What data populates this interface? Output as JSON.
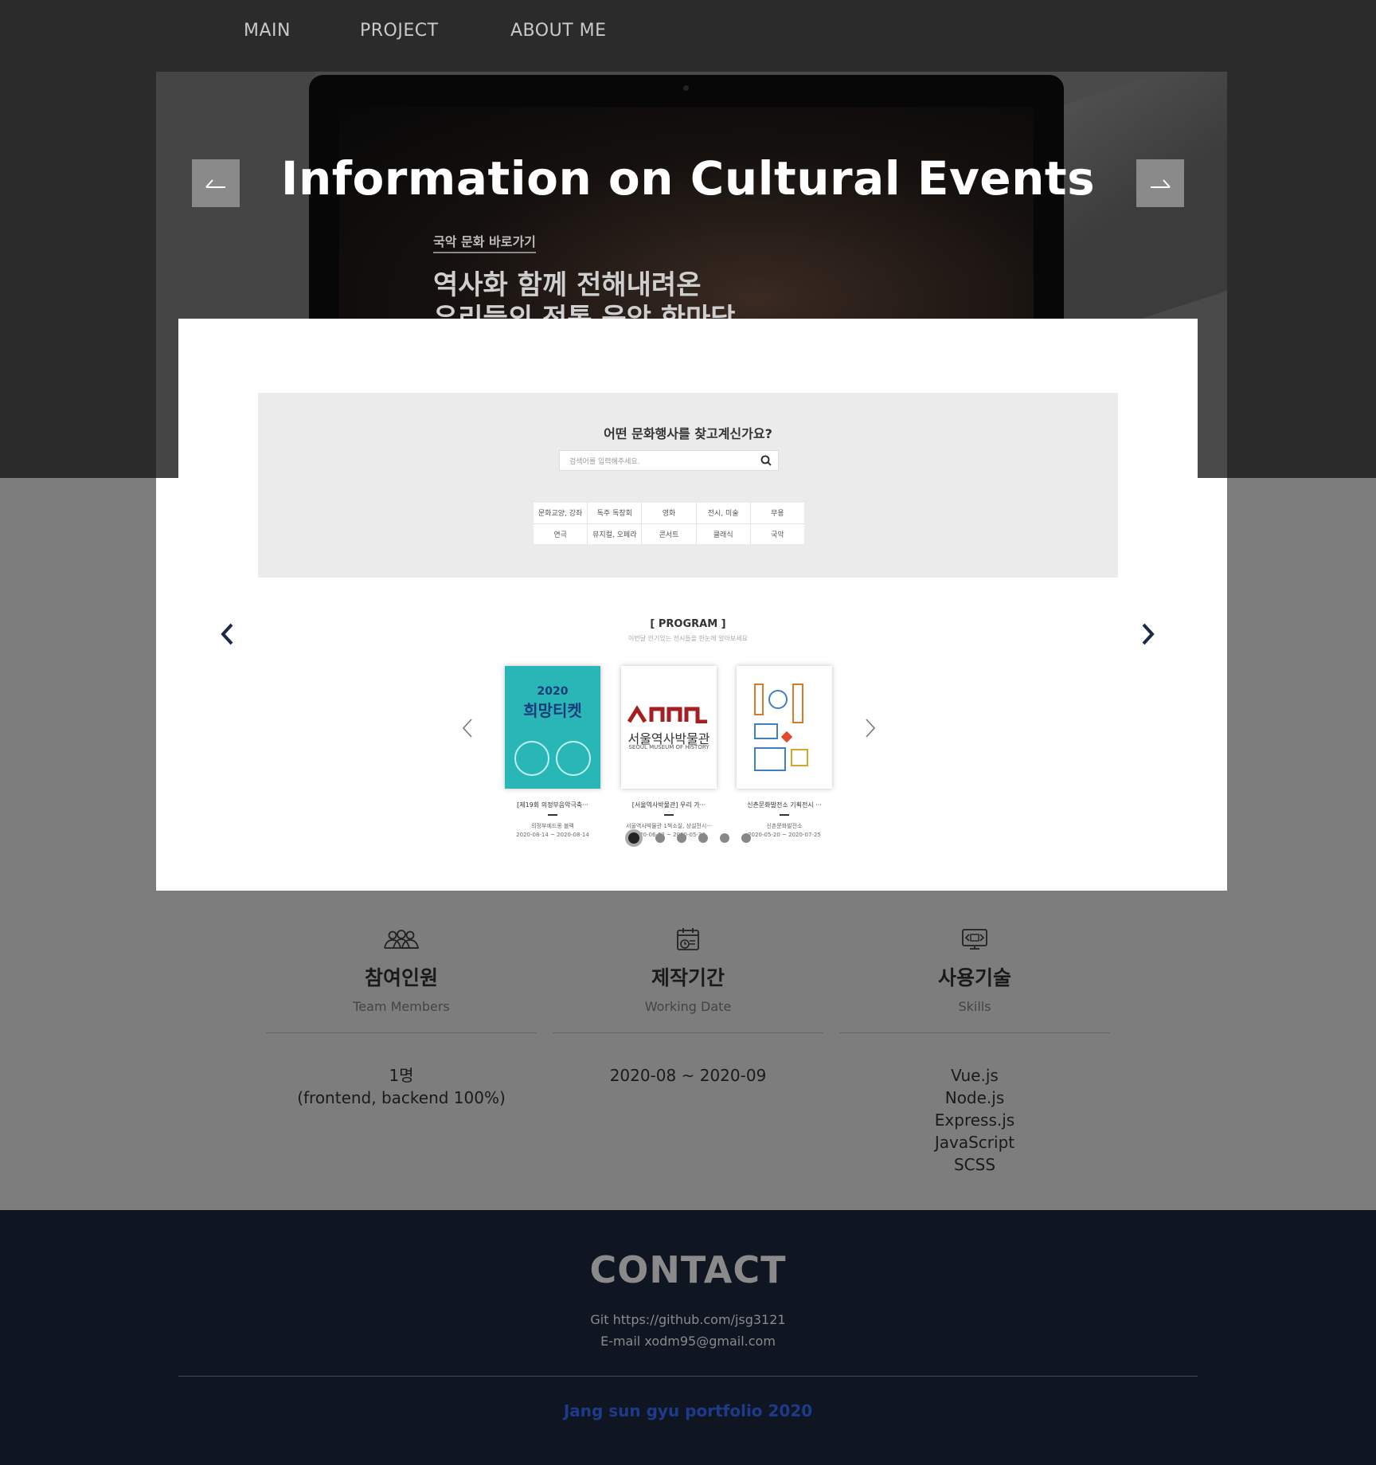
{
  "nav": {
    "items": [
      {
        "label": "MAIN"
      },
      {
        "label": "PROJECT"
      },
      {
        "label": "ABOUT ME"
      }
    ]
  },
  "hero": {
    "title": "Information on Cultural Events",
    "prev_icon": "arrow-left-icon",
    "next_icon": "arrow-right-icon",
    "screen": {
      "link_label": "국악 문화 바로가기",
      "line1": "역사화 함께 전해내려온",
      "line2": "우리들의 전통 음악 한마당"
    }
  },
  "preview": {
    "search_title": "어떤 문화행사를 찾고계신가요?",
    "search_placeholder": "검색어를 입력해주세요.",
    "search_icon": "search-icon",
    "categories": [
      "문화교양, 강좌",
      "독주 독창회",
      "영화",
      "전시, 미술",
      "무용",
      "연극",
      "뮤지컬, 오페라",
      "콘서트",
      "클래식",
      "국악"
    ],
    "program_title": "[ PROGRAM ]",
    "program_sub": "이번달 인기있는 전시들을 한눈에 알아보세요",
    "posters": [
      {
        "year": "2020",
        "title": "희망티켓",
        "caption": "[제19회 의정부음악극축···",
        "venue": "의정부예드몽 블랙",
        "dates": "2020-08-14 ~ 2020-08-14"
      },
      {
        "name": "서울역사박물관",
        "eng": "SEOUL MUSEUM OF HISTORY",
        "caption": "[서울역사박물관] 우리 가···",
        "venue": "서울역사박물관 1책소실, 상설전시···",
        "dates": "2020-06-02 ~ 2020-05-30"
      },
      {
        "caption": "신촌문화발전소 기획전시 ···",
        "venue": "신촌문화발전소",
        "dates": "2020-05-20 ~ 2020-07-25"
      }
    ],
    "dots": 6,
    "active_dot": 0
  },
  "info": [
    {
      "icon": "team-icon",
      "title": "참여인원",
      "sub": "Team Members",
      "value_lines": [
        "1명",
        "(frontend, backend 100%)"
      ]
    },
    {
      "icon": "calendar-icon",
      "title": "제작기간",
      "sub": "Working Date",
      "value_lines": [
        "2020-08 ~ 2020-09"
      ]
    },
    {
      "icon": "code-icon",
      "title": "사용기술",
      "sub": "Skills",
      "value_lines": [
        "Vue.js",
        "Node.js",
        "Express.js",
        "JavaScript",
        "SCSS"
      ]
    }
  ],
  "footer": {
    "title": "CONTACT",
    "git_label": "Git",
    "git_value": "https://github.com/jsg3121",
    "email_label": "E-mail",
    "email_value": "xodm95@gmail.com",
    "copyright": "Jang sun gyu portfolio 2020"
  },
  "colors": {
    "nav_bg": "#2b2b2b",
    "footer_bg": "#101522",
    "accent_blue": "#1e3a8a",
    "chevron": "#1c2a48"
  }
}
